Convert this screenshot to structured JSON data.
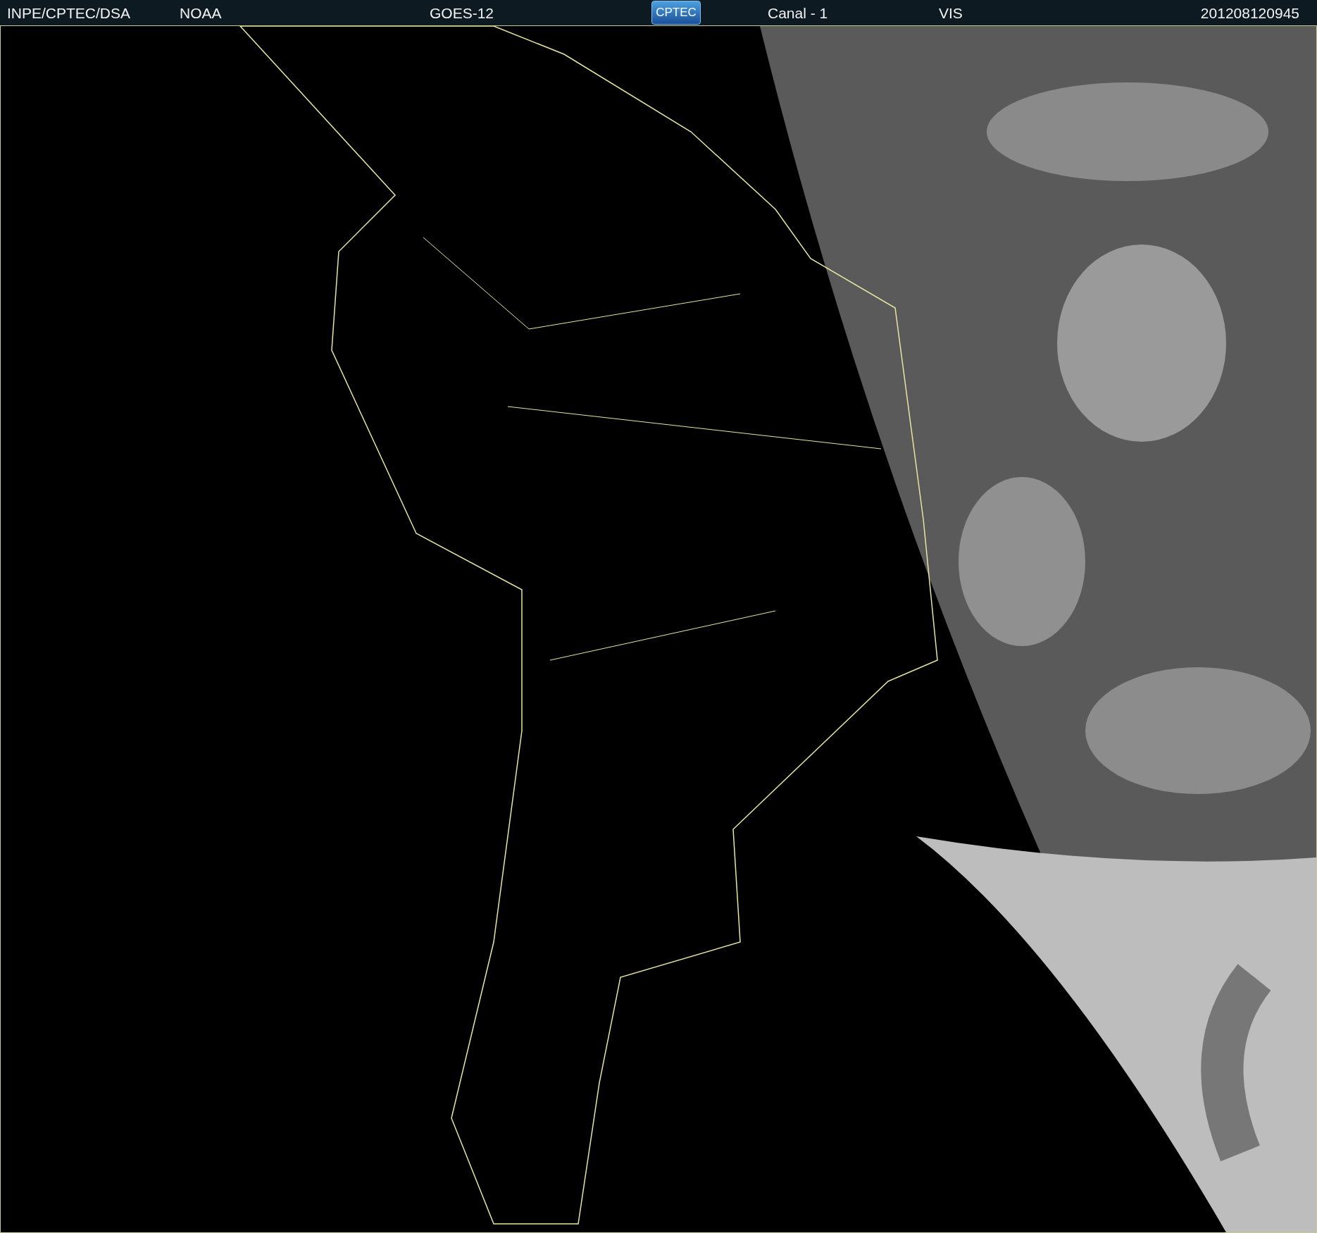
{
  "header": {
    "items": [
      {
        "kind": "text",
        "text": "INPE/CPTEC/DSA"
      },
      {
        "kind": "text",
        "text": "NOAA"
      },
      {
        "kind": "text",
        "text": "GOES-12"
      },
      {
        "kind": "logo",
        "text": "CPTEC"
      },
      {
        "kind": "text",
        "text": "Canal - 1"
      },
      {
        "kind": "text",
        "text": "VIS"
      },
      {
        "kind": "text",
        "text": "201208120945"
      }
    ]
  }
}
